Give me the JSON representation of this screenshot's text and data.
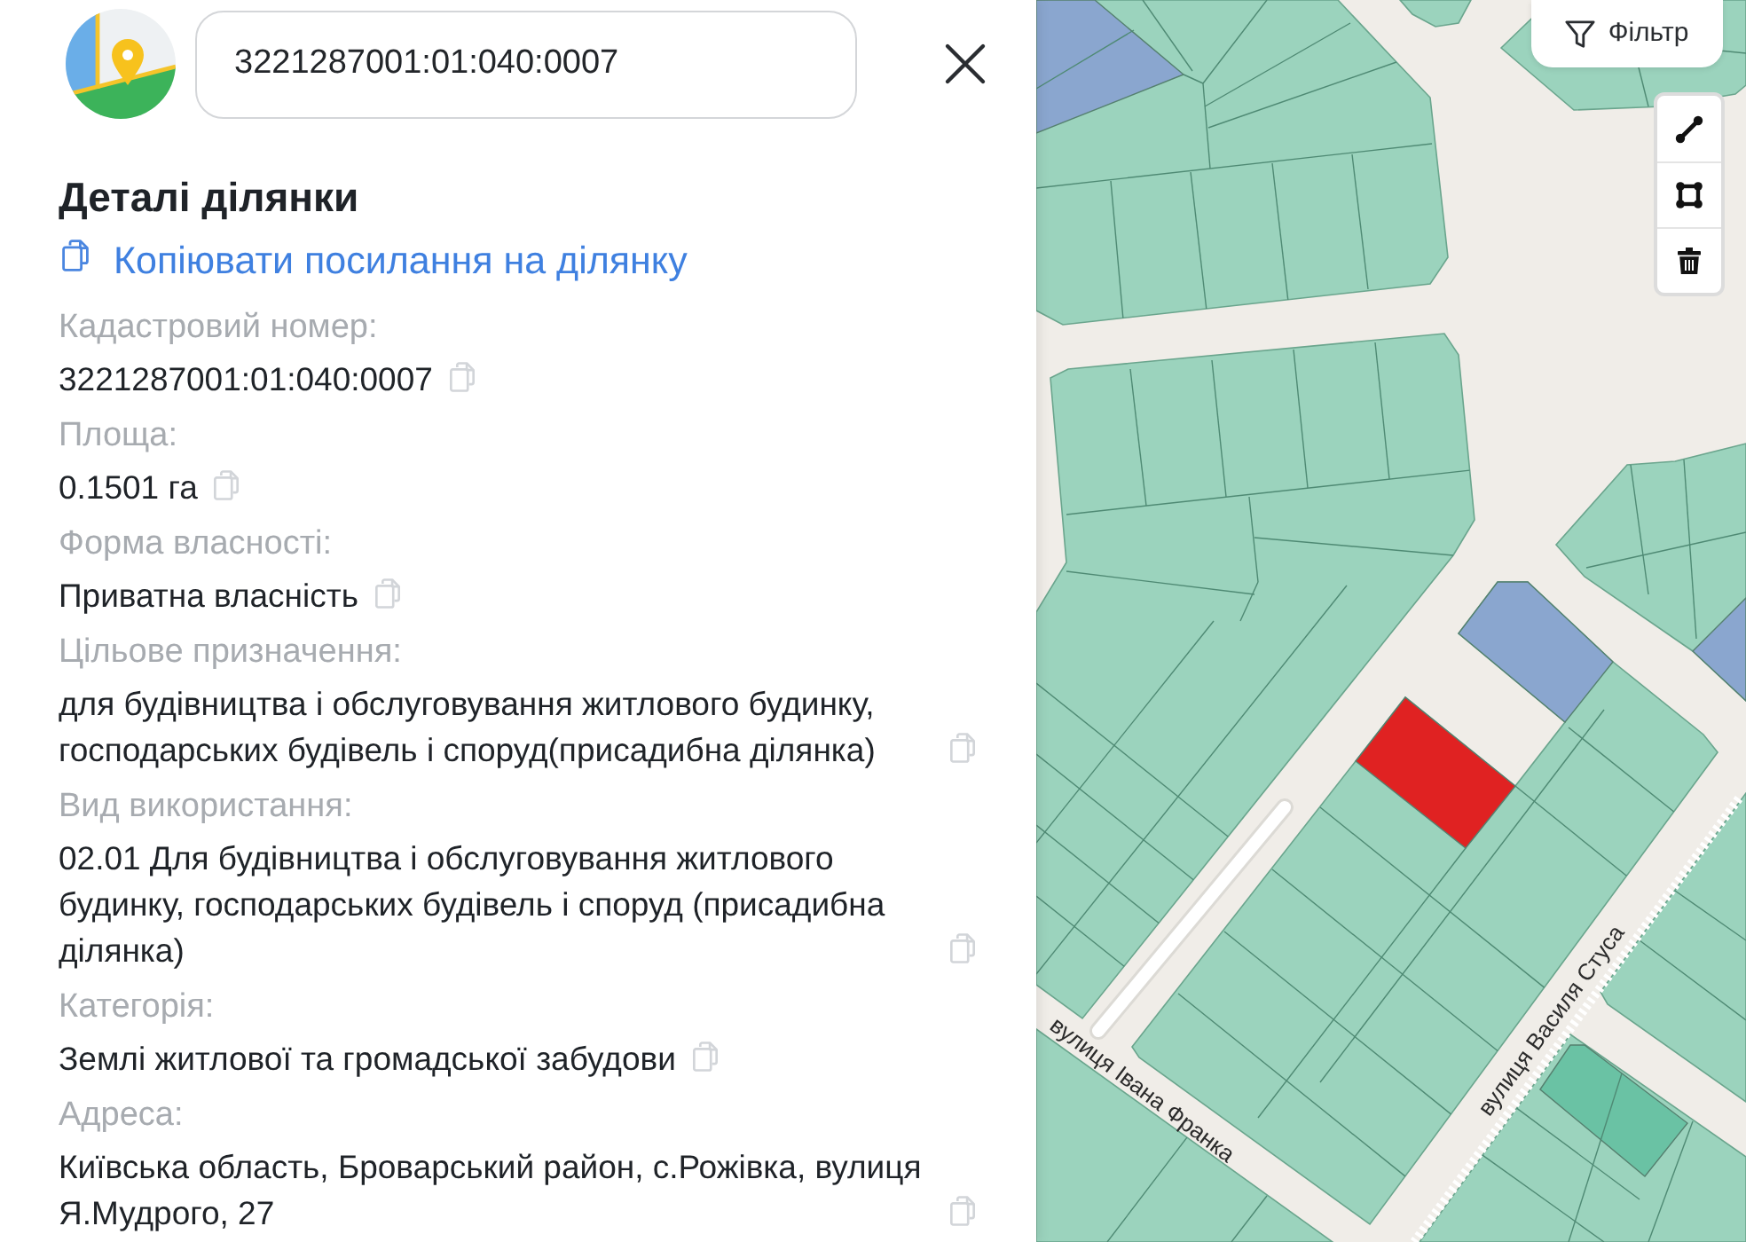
{
  "header": {
    "search": {
      "value": "3221287001:01:040:0007"
    }
  },
  "details": {
    "title": "Деталі ділянки",
    "copy_link": "Копіювати посилання на ділянку",
    "fields": [
      {
        "label": "Кадастровий номер:",
        "value": "3221287001:01:040:0007"
      },
      {
        "label": "Площа:",
        "value": "0.1501 га"
      },
      {
        "label": "Форма власності:",
        "value": "Приватна власність"
      },
      {
        "label": "Цільове призначення:",
        "value": "для будівництва і обслуговування житлового будинку, господарських будівель і споруд(присадибна ділянка)"
      },
      {
        "label": "Вид використання:",
        "value": "02.01 Для будівництва і обслуговування житлового будинку, господарських будівель і споруд (присадибна ділянка)"
      },
      {
        "label": "Категорія:",
        "value": "Землі житлової та громадської забудови"
      },
      {
        "label": "Адреса:",
        "value": "Київська область, Броварський район, с.Рожівка, вулиця Я.Мудрого, 27"
      }
    ]
  },
  "map": {
    "filter_button": "Фільтр",
    "street_labels": [
      "вулиця Івана Франка",
      "вулиця Василя Стуса"
    ]
  }
}
